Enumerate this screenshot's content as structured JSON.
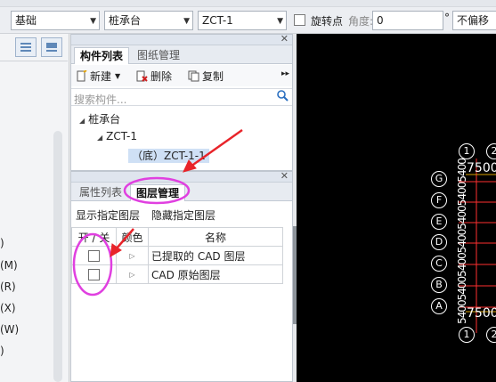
{
  "toolbar": {
    "combo1": "基础",
    "combo2": "桩承台",
    "combo3": "ZCT-1",
    "rotate_label": "旋转点",
    "angle_label": "角度:",
    "angle_value": "0",
    "degree_symbol": "°",
    "offset_value": "不偏移"
  },
  "left_panel": {
    "items": [
      ")",
      "(M)",
      "(R)",
      "(X)",
      "(W)",
      ")"
    ]
  },
  "component_panel": {
    "tabs": [
      "构件列表",
      "图纸管理"
    ],
    "new_label": "新建",
    "delete_label": "删除",
    "copy_label": "复制",
    "search_placeholder": "搜索构件...",
    "tree": {
      "root": "桩承台",
      "child": "ZCT-1",
      "leaf": "（底）ZCT-1-1"
    }
  },
  "layer_panel": {
    "tabs": [
      "属性列表",
      "图层管理"
    ],
    "show_label": "显示指定图层",
    "hide_label": "隐藏指定图层",
    "headers": [
      "开 / 关",
      "颜色",
      "名称"
    ],
    "rows": [
      {
        "name": "已提取的 CAD 图层"
      },
      {
        "name": "CAD 原始图层"
      }
    ]
  },
  "cad": {
    "top_markers": [
      "1",
      "2"
    ],
    "bottom_markers": [
      "1",
      "2"
    ],
    "row_markers": [
      "G",
      "F",
      "E",
      "D",
      "C",
      "B",
      "A"
    ],
    "dim_top": "7500",
    "dim_bottom": "7500",
    "vertical_dims": "5400540054005400540054005400"
  },
  "colors": {
    "annotation": "#e040e0",
    "arrow": "#e8242a",
    "cad_background": "#000000"
  }
}
